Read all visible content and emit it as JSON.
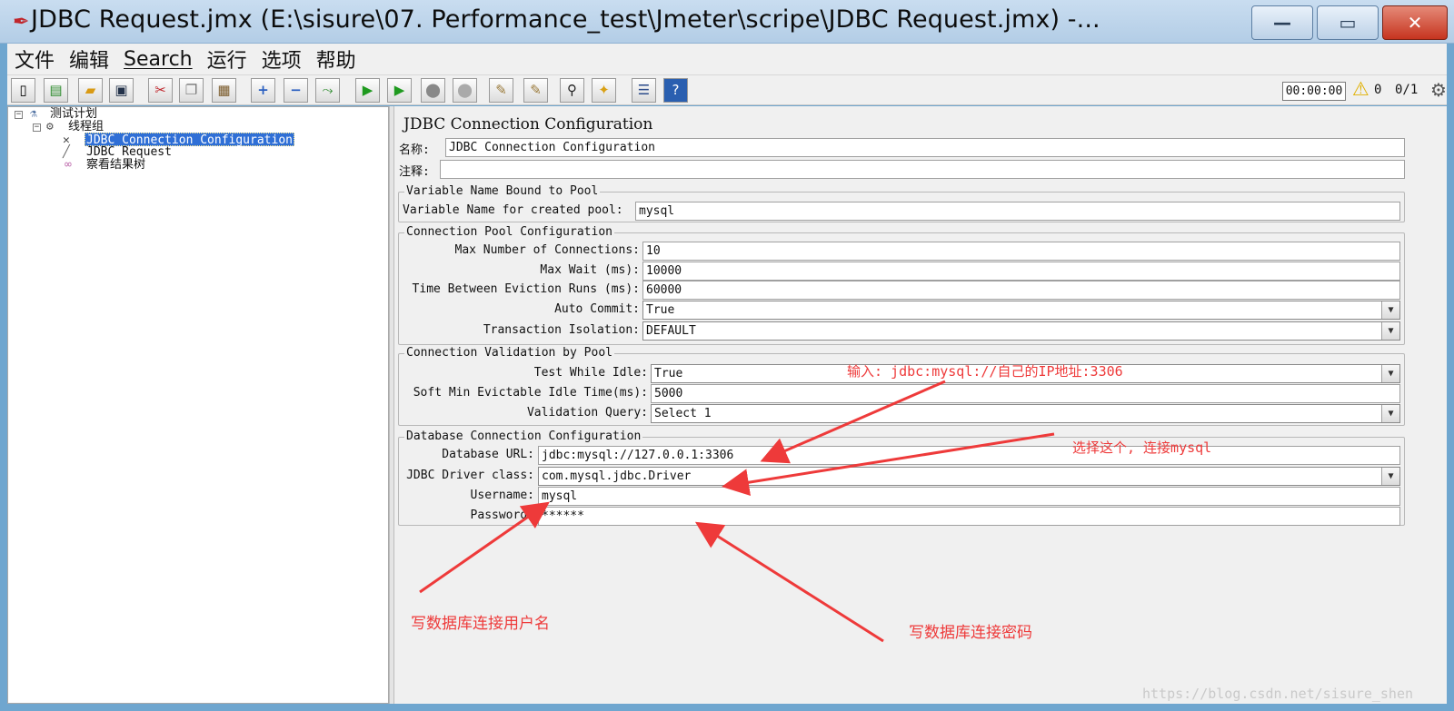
{
  "window": {
    "title": "JDBC Request.jmx (E:\\sisure\\07. Performance_test\\Jmeter\\scripe\\JDBC Request.jmx) -...",
    "minimize": "—",
    "maximize": "▭",
    "close": "✕"
  },
  "menu": [
    "文件",
    "编辑",
    "Search",
    "运行",
    "选项",
    "帮助"
  ],
  "toolbar": {
    "icons": [
      "new-icon",
      "templates-icon",
      "open-icon",
      "save-icon",
      "cut-icon",
      "copy-icon",
      "paste-icon",
      "expand-icon",
      "collapse-icon",
      "toggle-icon",
      "start-icon",
      "start-no-pause-icon",
      "stop-icon",
      "shutdown-icon",
      "clear-icon",
      "clear-all-icon",
      "search-icon",
      "reset-search-icon",
      "function-helper-icon",
      "help-icon"
    ],
    "timer": "00:00:00",
    "error_count": "0",
    "threads": "0/1"
  },
  "tree": {
    "root": "测试计划",
    "thread_group": "线程组",
    "items": [
      "JDBC Connection Configuration",
      "JDBC Request",
      "察看结果树"
    ]
  },
  "panel": {
    "title": "JDBC Connection Configuration",
    "name_label": "名称:",
    "name_value": "JDBC Connection Configuration",
    "comment_label": "注释:",
    "comment_value": "",
    "pool_group": {
      "title": "Variable Name Bound to Pool",
      "var_label": "Variable Name for created pool:",
      "var_value": "mysql"
    },
    "conn_pool": {
      "title": "Connection Pool Configuration",
      "max_conn_label": "Max Number of Connections:",
      "max_conn_value": "10",
      "max_wait_label": "Max Wait (ms):",
      "max_wait_value": "10000",
      "eviction_label": "Time Between Eviction Runs (ms):",
      "eviction_value": "60000",
      "auto_commit_label": "Auto Commit:",
      "auto_commit_value": "True",
      "isolation_label": "Transaction Isolation:",
      "isolation_value": "DEFAULT"
    },
    "validation": {
      "title": "Connection Validation by Pool",
      "idle_label": "Test While Idle:",
      "idle_value": "True",
      "soft_min_label": "Soft Min Evictable Idle Time(ms):",
      "soft_min_value": "5000",
      "query_label": "Validation Query:",
      "query_value": "Select 1"
    },
    "db": {
      "title": "Database Connection Configuration",
      "url_label": "Database URL:",
      "url_value": "jdbc:mysql://127.0.0.1:3306",
      "driver_label": "JDBC Driver class:",
      "driver_value": "com.mysql.jdbc.Driver",
      "user_label": "Username:",
      "user_value": "mysql",
      "pass_label": "Password:",
      "pass_value": "******"
    }
  },
  "annotations": {
    "url_hint": "输入: jdbc:mysql://自己的IP地址:3306",
    "driver_hint": "选择这个, 连接mysql",
    "user_hint": "写数据库连接用户名",
    "pass_hint": "写数据库连接密码",
    "color": "#ee3a3a"
  },
  "watermark": "https://blog.csdn.net/sisure_shen"
}
